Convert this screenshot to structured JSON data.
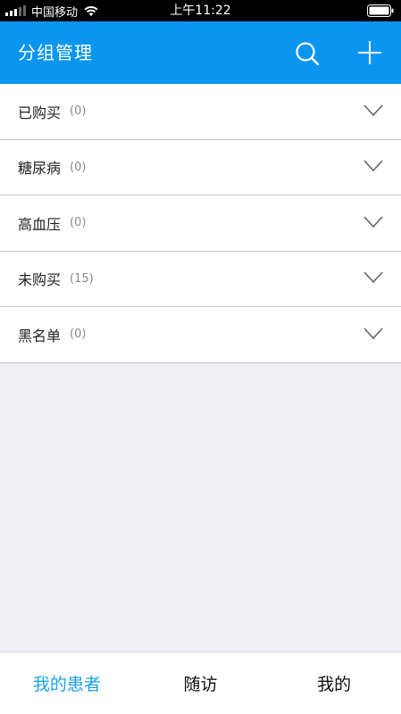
{
  "status_bar": {
    "carrier": "中国移动",
    "time": "上午11:22"
  },
  "nav": {
    "title": "分组管理",
    "search_icon": "search-icon",
    "add_icon": "plus-icon"
  },
  "groups": [
    {
      "name": "已购买",
      "count": "(0)"
    },
    {
      "name": "糖尿病",
      "count": "(0)"
    },
    {
      "name": "高血压",
      "count": "(0)"
    },
    {
      "name": "未购买",
      "count": "(15)"
    },
    {
      "name": "黑名单",
      "count": "(0)"
    }
  ],
  "tabs": [
    {
      "label": "我的患者",
      "active": true
    },
    {
      "label": "随访",
      "active": false
    },
    {
      "label": "我的",
      "active": false
    }
  ],
  "colors": {
    "nav_background": "#0a96f0",
    "tab_active": "#1aa3e6",
    "page_background": "#efeff4"
  }
}
